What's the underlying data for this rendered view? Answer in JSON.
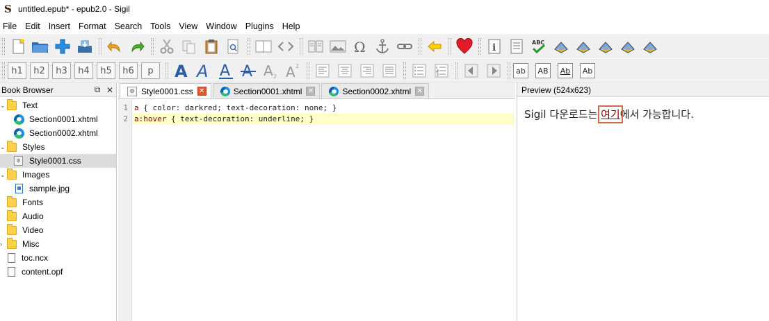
{
  "window": {
    "title": "untitled.epub* - epub2.0 - Sigil",
    "logo": "S"
  },
  "menu": [
    "File",
    "Edit",
    "Insert",
    "Format",
    "Search",
    "Tools",
    "View",
    "Window",
    "Plugins",
    "Help"
  ],
  "toolbar2": {
    "headings": [
      "h1",
      "h2",
      "h3",
      "h4",
      "h5",
      "h6",
      "p"
    ],
    "case_buttons": [
      "ab",
      "AB",
      "Ab",
      "Ab"
    ]
  },
  "book_browser": {
    "title": "Book Browser",
    "float_icon": "⧉",
    "close_icon": "✕",
    "items": [
      {
        "label": "Text",
        "type": "folder",
        "expanded": true
      },
      {
        "label": "Section0001.xhtml",
        "type": "xhtml"
      },
      {
        "label": "Section0002.xhtml",
        "type": "xhtml"
      },
      {
        "label": "Styles",
        "type": "folder",
        "expanded": true
      },
      {
        "label": "Style0001.css",
        "type": "css",
        "selected": true
      },
      {
        "label": "Images",
        "type": "folder",
        "expanded": true
      },
      {
        "label": "sample.jpg",
        "type": "image"
      },
      {
        "label": "Fonts",
        "type": "folder"
      },
      {
        "label": "Audio",
        "type": "folder"
      },
      {
        "label": "Video",
        "type": "folder"
      },
      {
        "label": "Misc",
        "type": "folder",
        "collapsed": true
      },
      {
        "label": "toc.ncx",
        "type": "doc"
      },
      {
        "label": "content.opf",
        "type": "doc"
      }
    ]
  },
  "editor": {
    "tabs": [
      {
        "label": "Style0001.css",
        "active": true
      },
      {
        "label": "Section0001.xhtml",
        "active": false
      },
      {
        "label": "Section0002.xhtml",
        "active": false
      }
    ],
    "line_numbers": [
      "1",
      "2"
    ],
    "code": [
      {
        "selector": "a",
        "rule": " { color: darkred; text-decoration: none; }"
      },
      {
        "selector": "a:hover",
        "rule": " { text-decoration: underline; }"
      }
    ]
  },
  "preview": {
    "title": "Preview (524x623)",
    "text_before": "Sigil 다운로드는 ",
    "link_text": "여기",
    "text_after": "에서 가능합니다."
  },
  "colors": {
    "toolbar_bg": "#f0f0f0",
    "active_close": "#e8542a",
    "link": "#8b0000",
    "current_line": "#ffffc8",
    "folder": "#ffd14a"
  }
}
